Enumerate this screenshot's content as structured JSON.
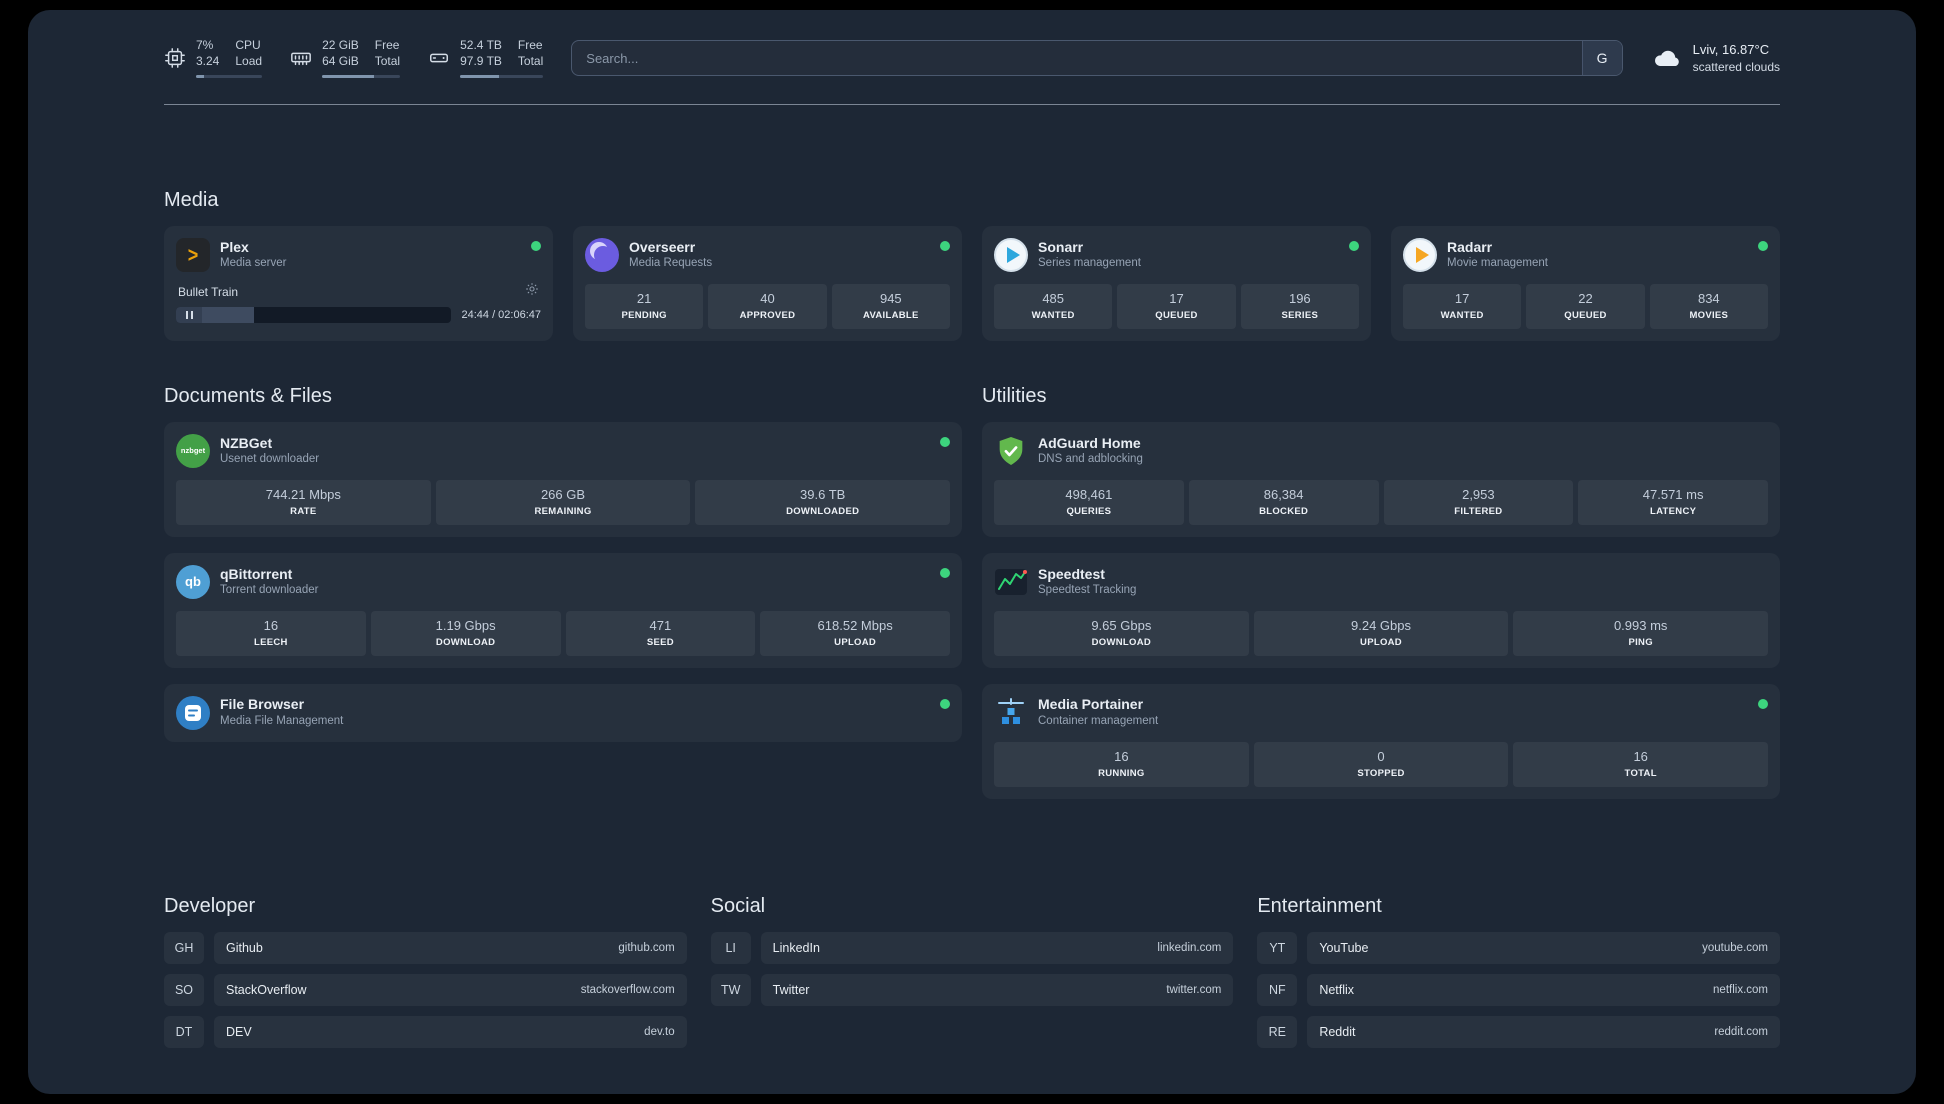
{
  "topbar": {
    "resources": [
      {
        "icon": "cpu-icon",
        "value_top": "7%",
        "value_bottom": "3.24",
        "label_top": "CPU",
        "label_bottom": "Load",
        "progress": 12
      },
      {
        "icon": "memory-icon",
        "value_top": "22 GiB",
        "value_bottom": "64 GiB",
        "label_top": "Free",
        "label_bottom": "Total",
        "progress": 66
      },
      {
        "icon": "disk-icon",
        "value_top": "52.4 TB",
        "value_bottom": "97.9 TB",
        "label_top": "Free",
        "label_bottom": "Total",
        "progress": 47
      }
    ],
    "search": {
      "placeholder": "Search...",
      "provider_button": "G"
    },
    "weather": {
      "location": "Lviv, 16.87°C",
      "condition": "scattered clouds"
    }
  },
  "sections": {
    "media": {
      "title": "Media",
      "plex": {
        "name": "Plex",
        "desc": "Media server",
        "now_playing": "Bullet Train",
        "time": "24:44 / 02:06:47",
        "progress": 19
      },
      "overseerr": {
        "name": "Overseerr",
        "desc": "Media Requests",
        "stats": [
          {
            "value": "21",
            "label": "PENDING"
          },
          {
            "value": "40",
            "label": "APPROVED"
          },
          {
            "value": "945",
            "label": "AVAILABLE"
          }
        ]
      },
      "sonarr": {
        "name": "Sonarr",
        "desc": "Series management",
        "stats": [
          {
            "value": "485",
            "label": "WANTED"
          },
          {
            "value": "17",
            "label": "QUEUED"
          },
          {
            "value": "196",
            "label": "SERIES"
          }
        ]
      },
      "radarr": {
        "name": "Radarr",
        "desc": "Movie management",
        "stats": [
          {
            "value": "17",
            "label": "WANTED"
          },
          {
            "value": "22",
            "label": "QUEUED"
          },
          {
            "value": "834",
            "label": "MOVIES"
          }
        ]
      }
    },
    "documents": {
      "title": "Documents & Files",
      "nzbget": {
        "name": "NZBGet",
        "desc": "Usenet downloader",
        "icon_text": "nzbget",
        "stats": [
          {
            "value": "744.21 Mbps",
            "label": "RATE"
          },
          {
            "value": "266 GB",
            "label": "REMAINING"
          },
          {
            "value": "39.6 TB",
            "label": "DOWNLOADED"
          }
        ]
      },
      "qbittorrent": {
        "name": "qBittorrent",
        "desc": "Torrent downloader",
        "icon_text": "qb",
        "stats": [
          {
            "value": "16",
            "label": "LEECH"
          },
          {
            "value": "1.19 Gbps",
            "label": "DOWNLOAD"
          },
          {
            "value": "471",
            "label": "SEED"
          },
          {
            "value": "618.52 Mbps",
            "label": "UPLOAD"
          }
        ]
      },
      "filebrowser": {
        "name": "File Browser",
        "desc": "Media File Management"
      }
    },
    "utilities": {
      "title": "Utilities",
      "adguard": {
        "name": "AdGuard Home",
        "desc": "DNS and adblocking",
        "stats": [
          {
            "value": "498,461",
            "label": "QUERIES"
          },
          {
            "value": "86,384",
            "label": "BLOCKED"
          },
          {
            "value": "2,953",
            "label": "FILTERED"
          },
          {
            "value": "47.571 ms",
            "label": "LATENCY"
          }
        ]
      },
      "speedtest": {
        "name": "Speedtest",
        "desc": "Speedtest Tracking",
        "stats": [
          {
            "value": "9.65 Gbps",
            "label": "DOWNLOAD"
          },
          {
            "value": "9.24 Gbps",
            "label": "UPLOAD"
          },
          {
            "value": "0.993 ms",
            "label": "PING"
          }
        ]
      },
      "portainer": {
        "name": "Media Portainer",
        "desc": "Container management",
        "stats": [
          {
            "value": "16",
            "label": "RUNNING"
          },
          {
            "value": "0",
            "label": "STOPPED"
          },
          {
            "value": "16",
            "label": "TOTAL"
          }
        ]
      }
    },
    "bookmarks": [
      {
        "title": "Developer",
        "items": [
          {
            "abbr": "GH",
            "name": "Github",
            "url": "github.com"
          },
          {
            "abbr": "SO",
            "name": "StackOverflow",
            "url": "stackoverflow.com"
          },
          {
            "abbr": "DT",
            "name": "DEV",
            "url": "dev.to"
          }
        ]
      },
      {
        "title": "Social",
        "items": [
          {
            "abbr": "LI",
            "name": "LinkedIn",
            "url": "linkedin.com"
          },
          {
            "abbr": "TW",
            "name": "Twitter",
            "url": "twitter.com"
          }
        ]
      },
      {
        "title": "Entertainment",
        "items": [
          {
            "abbr": "YT",
            "name": "YouTube",
            "url": "youtube.com"
          },
          {
            "abbr": "NF",
            "name": "Netflix",
            "url": "netflix.com"
          },
          {
            "abbr": "RE",
            "name": "Reddit",
            "url": "reddit.com"
          }
        ]
      }
    ]
  },
  "colors": {
    "status_online": "#3dd47e",
    "progress_fill": "#8095ad"
  }
}
